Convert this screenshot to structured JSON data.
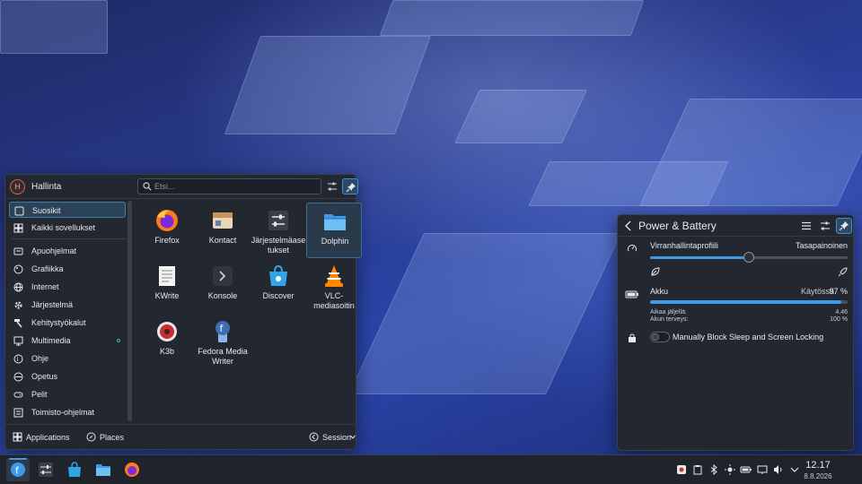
{
  "launcher": {
    "user_initial": "H",
    "user_name": "Hallinta",
    "search_placeholder": "Etsi...",
    "categories": [
      {
        "label": "Suosikit",
        "icon": "bookmark-icon"
      },
      {
        "label": "Kaikki sovellukset",
        "icon": "grid-icon"
      },
      {
        "label": "Apuohjelmat",
        "icon": "accessories-icon"
      },
      {
        "label": "Grafiikka",
        "icon": "graphics-icon"
      },
      {
        "label": "Internet",
        "icon": "globe-icon"
      },
      {
        "label": "Järjestelmä",
        "icon": "gear-icon"
      },
      {
        "label": "Kehitystyökalut",
        "icon": "hammer-icon"
      },
      {
        "label": "Multimedia",
        "icon": "multimedia-icon"
      },
      {
        "label": "Ohje",
        "icon": "help-icon"
      },
      {
        "label": "Opetus",
        "icon": "education-icon"
      },
      {
        "label": "Pelit",
        "icon": "gamepad-icon"
      },
      {
        "label": "Toimisto-ohjelmat",
        "icon": "office-icon"
      }
    ],
    "apps": [
      {
        "label": "Firefox",
        "icon": "firefox-icon"
      },
      {
        "label": "Kontact",
        "icon": "kontact-icon"
      },
      {
        "label": "Järjestelmäase tukset",
        "icon": "system-settings-icon"
      },
      {
        "label": "Dolphin",
        "icon": "dolphin-folder-icon"
      },
      {
        "label": "KWrite",
        "icon": "kwrite-icon"
      },
      {
        "label": "Konsole",
        "icon": "konsole-icon"
      },
      {
        "label": "Discover",
        "icon": "discover-icon"
      },
      {
        "label": "VLC-mediasoitin",
        "icon": "vlc-icon"
      },
      {
        "label": "K3b",
        "icon": "k3b-icon"
      },
      {
        "label": "Fedora Media Writer",
        "icon": "fedora-media-writer-icon"
      }
    ],
    "footer": {
      "applications_label": "Applications",
      "places_label": "Places",
      "session_label": "Session"
    }
  },
  "power": {
    "title": "Power & Battery",
    "profile_label": "Virranhallintaprofiili",
    "profile_value": "Tasapainoinen",
    "profile_level": 0.5,
    "battery_label": "Akku",
    "battery_status": "Käytössä",
    "battery_percent": "97 %",
    "battery_level": 0.97,
    "time_left_label": "Aikaa jäljellä:",
    "time_left_value": "4.46",
    "health_label": "Akun terveys:",
    "health_value": "100 %",
    "block_sleep_label": "Manually Block Sleep and Screen Locking",
    "block_sleep_on": false
  },
  "taskbar": {
    "items": [
      "fedora-launcher-icon",
      "system-settings-icon",
      "discover-icon",
      "dolphin-folder-icon",
      "firefox-icon"
    ],
    "tray": [
      "vault-icon",
      "clipboard-icon",
      "bluetooth-icon",
      "brightness-icon",
      "battery-icon",
      "display-icon",
      "network-icon",
      "volume-icon",
      "pin-icon",
      "chevron-up-icon"
    ],
    "time": "12.17",
    "date": "8.8.2026"
  },
  "colors": {
    "accent": "#3d9ae8",
    "panel": "#232830",
    "taskbar": "#1f242b"
  }
}
